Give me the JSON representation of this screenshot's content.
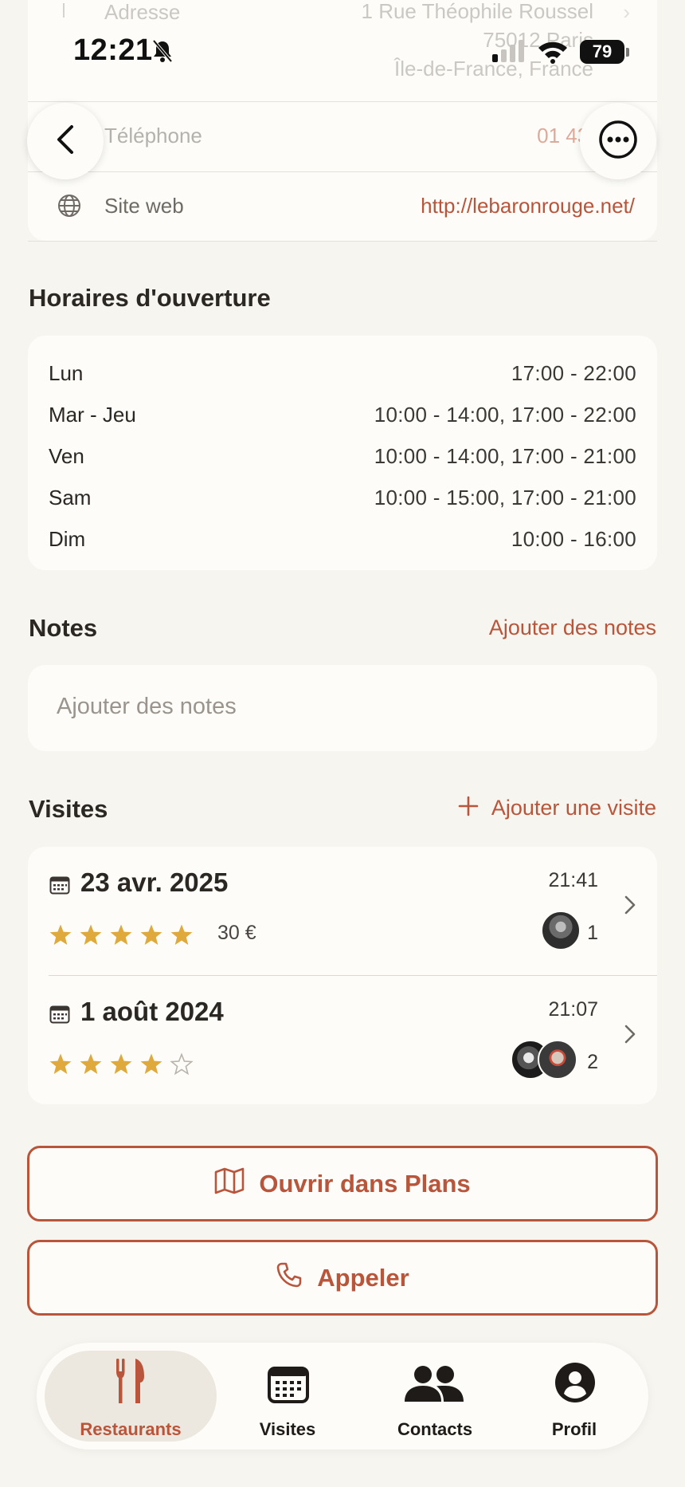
{
  "status_bar": {
    "time": "12:21",
    "battery": "79"
  },
  "contact": {
    "address_label": "Adresse",
    "address_lines": [
      "1 Rue Théophile Roussel",
      "75012 Paris",
      "Île-de-France, France"
    ],
    "phone_label": "Téléphone",
    "phone_value": "01 43 43 1",
    "website_label": "Site web",
    "website_value": "http://lebaronrouge.net/"
  },
  "hours": {
    "title": "Horaires d'ouverture",
    "rows": [
      {
        "day": "Lun",
        "hours": "17:00 - 22:00"
      },
      {
        "day": "Mar - Jeu",
        "hours": "10:00 - 14:00, 17:00 - 22:00"
      },
      {
        "day": "Ven",
        "hours": "10:00 - 14:00, 17:00 - 21:00"
      },
      {
        "day": "Sam",
        "hours": "10:00 - 15:00, 17:00 - 21:00"
      },
      {
        "day": "Dim",
        "hours": "10:00 - 16:00"
      }
    ]
  },
  "notes": {
    "title": "Notes",
    "add_link": "Ajouter des notes",
    "placeholder": "Ajouter des notes"
  },
  "visits": {
    "title": "Visites",
    "add_link": "Ajouter une visite",
    "items": [
      {
        "date": "23 avr. 2025",
        "time": "21:41",
        "rating": 5,
        "price": "30 €",
        "participants": "1"
      },
      {
        "date": "1 août 2024",
        "time": "21:07",
        "rating": 4,
        "price": "",
        "participants": "2"
      }
    ]
  },
  "actions": {
    "open_maps": "Ouvrir dans Plans",
    "call": "Appeler"
  },
  "tabbar": {
    "tabs": [
      {
        "label": "Restaurants",
        "active": true
      },
      {
        "label": "Visites",
        "active": false
      },
      {
        "label": "Contacts",
        "active": false
      },
      {
        "label": "Profil",
        "active": false
      }
    ]
  },
  "colors": {
    "accent": "#b8553a",
    "star": "#e0a93b",
    "background": "#f7f5f0",
    "card": "#fdfcf8"
  }
}
